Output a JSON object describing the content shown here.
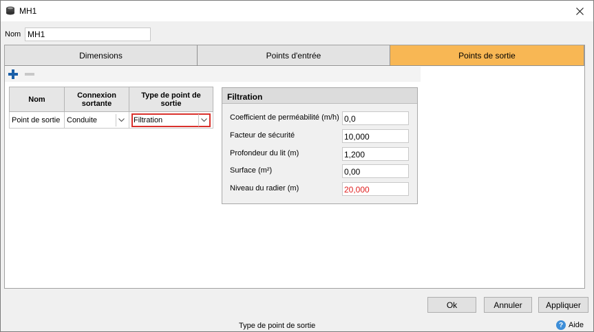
{
  "window": {
    "title": "MH1",
    "icons": {
      "app": "manhole-icon",
      "close": "close-icon"
    }
  },
  "name_field": {
    "label": "Nom",
    "value": "MH1"
  },
  "tabs": [
    {
      "label": "Dimensions",
      "active": false
    },
    {
      "label": "Points d'entrée",
      "active": false
    },
    {
      "label": "Points de sortie",
      "active": true
    }
  ],
  "toolbar": {
    "add_icon": "plus-icon",
    "remove_icon": "minus-icon"
  },
  "outlets_table": {
    "headers": [
      "Nom",
      "Connexion sortante",
      "Type de point de sortie"
    ],
    "rows": [
      {
        "name": "Point de sortie",
        "connection": "Conduite",
        "type": "Filtration"
      }
    ]
  },
  "filtration": {
    "title": "Filtration",
    "fields": [
      {
        "label": "Coefficient de perméabilité (m/h)",
        "value": "0,0",
        "color": "#000000"
      },
      {
        "label": "Facteur de sécurité",
        "value": "10,000",
        "color": "#000000"
      },
      {
        "label": "Profondeur du lit (m)",
        "value": "1,200",
        "color": "#000000"
      },
      {
        "label": "Surface (m²)",
        "value": "0,00",
        "color": "#000000"
      },
      {
        "label": "Niveau du radier (m)",
        "value": "20,000",
        "color": "#e02020"
      }
    ]
  },
  "buttons": {
    "ok": "Ok",
    "cancel": "Annuler",
    "apply": "Appliquer"
  },
  "status_text": "Type de point de sortie",
  "help": {
    "label": "Aide",
    "icon": "help-icon"
  },
  "colors": {
    "active_tab": "#f8b754",
    "highlight_border": "#d9302b",
    "accent_blue": "#1a5fa8"
  }
}
